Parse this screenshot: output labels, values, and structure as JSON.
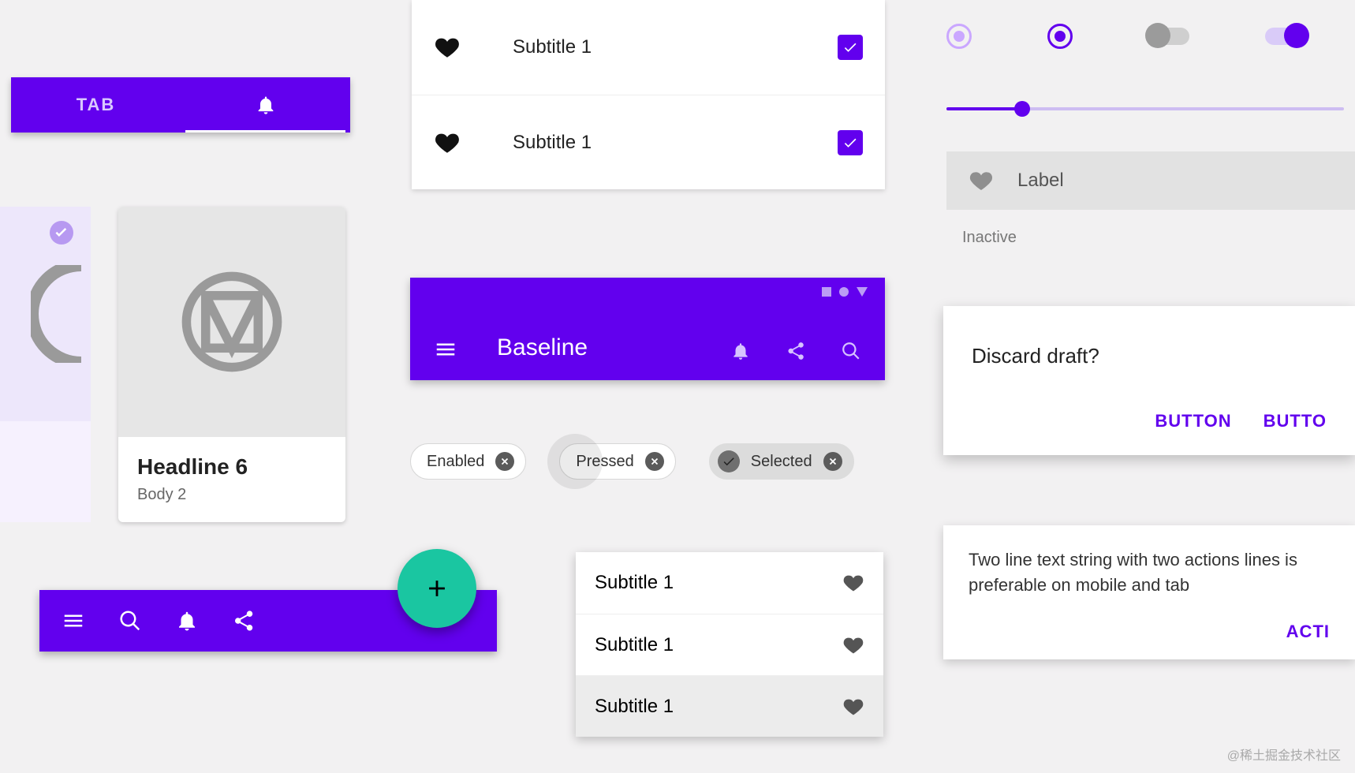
{
  "colors": {
    "primary": "#6200EE",
    "secondary": "#1AC6A1"
  },
  "tabs": {
    "label": "TAB"
  },
  "card": {
    "headline": "Headline 6",
    "body": "Body 2"
  },
  "list": {
    "items": [
      {
        "title": "Subtitle 1",
        "checked": true
      },
      {
        "title": "Subtitle 1",
        "checked": true
      }
    ]
  },
  "appbar": {
    "title": "Baseline"
  },
  "chips": {
    "enabled": "Enabled",
    "pressed": "Pressed",
    "selected": "Selected"
  },
  "menu": {
    "items": [
      "Subtitle 1",
      "Subtitle 1",
      "Subtitle 1"
    ],
    "selected_index": 2
  },
  "right": {
    "chip_label": "Label",
    "chip_caption": "Inactive",
    "slider_value": 18,
    "radios": [
      {
        "checked": true,
        "disabled": true
      },
      {
        "checked": true,
        "disabled": false
      }
    ],
    "switches": [
      {
        "on": false
      },
      {
        "on": true
      }
    ]
  },
  "dialog": {
    "title": "Discard draft?",
    "action1": "BUTTON",
    "action2": "BUTTO"
  },
  "banner": {
    "text": "Two line text string with two actions lines is preferable on mobile and tab",
    "action": "ACTI"
  },
  "watermark": "@稀土掘金技术社区"
}
